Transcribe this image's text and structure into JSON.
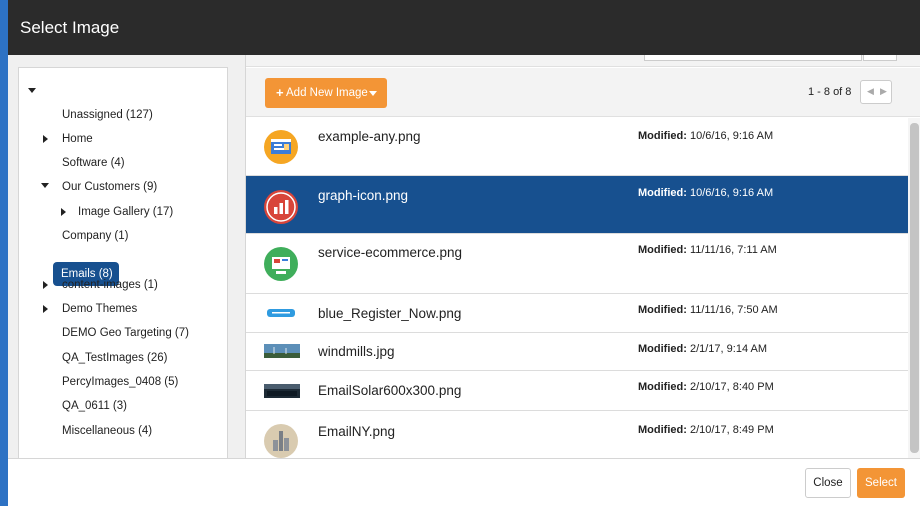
{
  "dialog": {
    "title": "Select Image"
  },
  "tree": {
    "items": [
      {
        "label": "Unassigned (127)",
        "toggle": "none"
      },
      {
        "label": "Home",
        "toggle": "collapsed"
      },
      {
        "label": "Software (4)",
        "toggle": "none"
      },
      {
        "label": "Our Customers (9)",
        "toggle": "expanded"
      },
      {
        "label": "Image Gallery (17)",
        "toggle": "collapsed"
      },
      {
        "label": "Company (1)",
        "toggle": "none"
      },
      {
        "label": "Emails (8)",
        "toggle": "none",
        "selected": true
      },
      {
        "label": "content-images (1)",
        "toggle": "collapsed"
      },
      {
        "label": "Demo Themes",
        "toggle": "collapsed"
      },
      {
        "label": "DEMO Geo Targeting (7)",
        "toggle": "none"
      },
      {
        "label": "QA_TestImages (26)",
        "toggle": "none"
      },
      {
        "label": "PercyImages_0408 (5)",
        "toggle": "none"
      },
      {
        "label": "QA_0611 (3)",
        "toggle": "none"
      },
      {
        "label": "Miscellaneous (4)",
        "toggle": "none"
      }
    ]
  },
  "toolbar": {
    "add_label": "Add New Image",
    "pager_text": "1 - 8 of 8",
    "prev_glyph": "◀",
    "next_glyph": "▶"
  },
  "files": {
    "modified_label": "Modified:",
    "rows": [
      {
        "name": "example-any.png",
        "modified": "10/6/16, 9:16 AM",
        "thumb": "browser-icon"
      },
      {
        "name": "graph-icon.png",
        "modified": "10/6/16, 9:16 AM",
        "thumb": "graph-icon",
        "selected": true
      },
      {
        "name": "service-ecommerce.png",
        "modified": "11/11/16, 7:11 AM",
        "thumb": "ecommerce-icon"
      },
      {
        "name": "blue_Register_Now.png",
        "modified": "11/11/16, 7:50 AM",
        "thumb": "register-banner"
      },
      {
        "name": "windmills.jpg",
        "modified": "2/1/17, 9:14 AM",
        "thumb": "windmills-photo"
      },
      {
        "name": "EmailSolar600x300.png",
        "modified": "2/10/17, 8:40 PM",
        "thumb": "solar-photo"
      },
      {
        "name": "EmailNY.png",
        "modified": "2/10/17, 8:49 PM",
        "thumb": "ny-photo"
      }
    ]
  },
  "footer": {
    "close_label": "Close",
    "select_label": "Select"
  },
  "colors": {
    "header": "#2b2b2b",
    "accent_orange": "#f39536",
    "selected_blue": "#17508f",
    "frame_blue": "#2d72c4"
  }
}
